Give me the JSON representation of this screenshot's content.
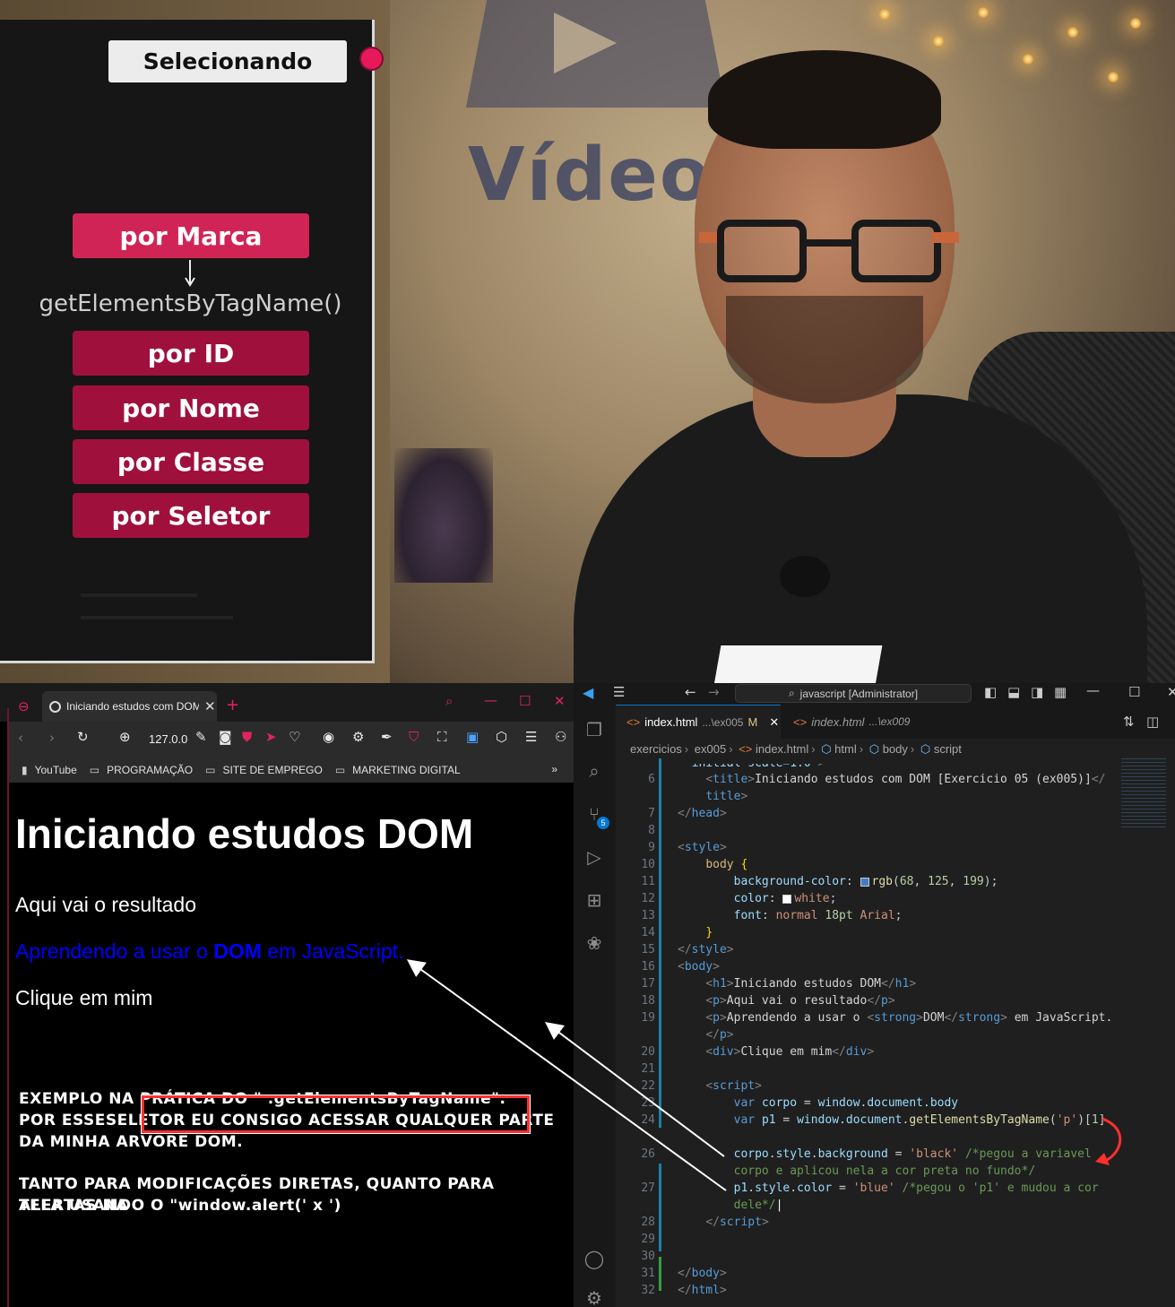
{
  "video": {
    "logo_text": "Vídeo",
    "slide": {
      "title": "Selecionando",
      "buttons": [
        "por Marca",
        "por ID",
        "por Nome",
        "por Classe",
        "por Seletor"
      ],
      "method": "getElementsByTagName()"
    }
  },
  "browser": {
    "tab_title": "Iniciando estudos com DOM",
    "new_tab": "+",
    "address": "127.0.0",
    "bookmarks": [
      "YouTube",
      "PROGRAMAÇÃO",
      "SITE DE EMPREGO",
      "MARKETING DIGITAL"
    ],
    "more_bookmarks": "»",
    "page": {
      "h1": "Iniciando estudos DOM",
      "p1": "Aqui vai o resultado",
      "p2_before": "Aprendendo a usar o ",
      "p2_strong": "DOM",
      "p2_after": " em JavaScript.",
      "div": "Clique em mim"
    },
    "notes": [
      "EXEMPLO NA PRÁTICA DO  \" .getElementsByTagName\".",
      "POR ESSESELETOR EU CONSIGO ACESSAR QUALQUER PARTE",
      "DA MINHA ARVORE DOM.",
      "TANTO PARA MODIFICAÇÕES DIRETAS, QUANTO PARA ALERTAS NA",
      "TELA USANDO O \"window.alert(' x ')"
    ]
  },
  "vscode": {
    "search": "javascript [Administrator]",
    "tabs": [
      {
        "name": "index.html",
        "path": "...\\ex005",
        "status": "M"
      },
      {
        "name": "index.html",
        "path": "...\\ex009"
      }
    ],
    "breadcrumb": [
      "exercicios",
      "ex005",
      "index.html",
      "html",
      "body",
      "script"
    ],
    "scm_badge": "5",
    "line_numbers": [
      "6",
      "",
      "7",
      "8",
      "9",
      "10",
      "11",
      "12",
      "13",
      "14",
      "15",
      "16",
      "17",
      "18",
      "19",
      "",
      "20",
      "21",
      "22",
      "23",
      "24",
      "",
      "26",
      "",
      "27",
      "",
      "28",
      "29",
      "30",
      "31",
      "32"
    ]
  },
  "colors": {
    "accent_pink": "#d12456",
    "accent_dark_pink": "#a0103d",
    "vscode_blue": "#0078d4",
    "highlight_red": "#ff2f2f"
  }
}
